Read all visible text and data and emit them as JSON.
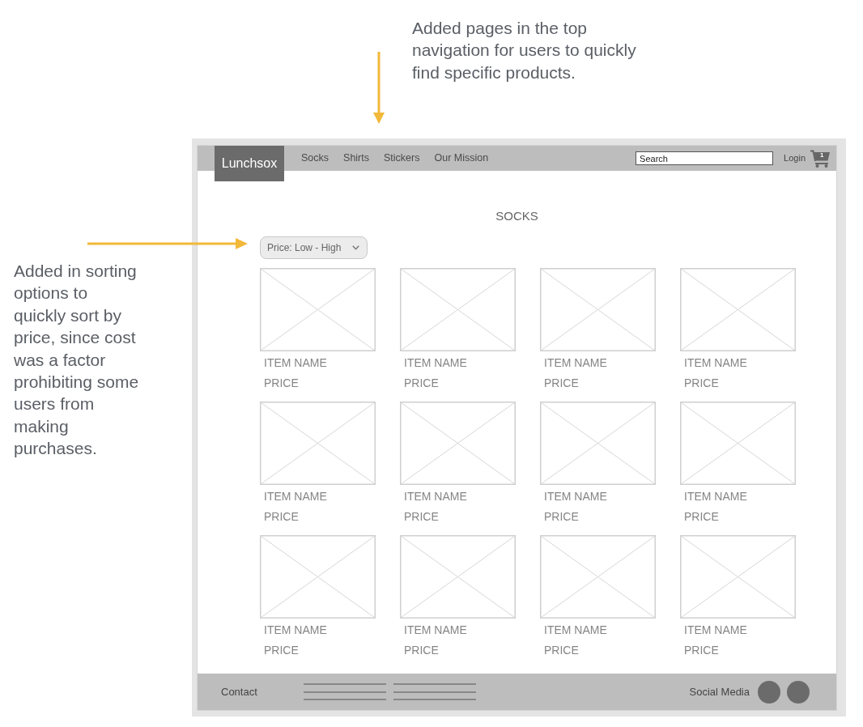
{
  "notes": {
    "top": "Added pages in the top navigation for users to quickly find specific products.",
    "left": "Added in sorting options to quickly sort by price, since cost was a factor prohibiting some users from making purchases."
  },
  "navbar": {
    "logo": "Lunchsox",
    "links": [
      {
        "label": "Socks"
      },
      {
        "label": "Shirts"
      },
      {
        "label": "Stickers"
      },
      {
        "label": "Our Mission"
      }
    ],
    "search": {
      "placeholder": "Search"
    },
    "login": "Login",
    "cart": {
      "count": "1"
    }
  },
  "page": {
    "title": "SOCKS",
    "sort": {
      "value": "Price: Low - High"
    }
  },
  "products": [
    {
      "name": "ITEM NAME",
      "price": "PRICE"
    },
    {
      "name": "ITEM NAME",
      "price": "PRICE"
    },
    {
      "name": "ITEM NAME",
      "price": "PRICE"
    },
    {
      "name": "ITEM NAME",
      "price": "PRICE"
    },
    {
      "name": "ITEM NAME",
      "price": "PRICE"
    },
    {
      "name": "ITEM NAME",
      "price": "PRICE"
    },
    {
      "name": "ITEM NAME",
      "price": "PRICE"
    },
    {
      "name": "ITEM NAME",
      "price": "PRICE"
    },
    {
      "name": "ITEM NAME",
      "price": "PRICE"
    },
    {
      "name": "ITEM NAME",
      "price": "PRICE"
    },
    {
      "name": "ITEM NAME",
      "price": "PRICE"
    },
    {
      "name": "ITEM NAME",
      "price": "PRICE"
    }
  ],
  "footer": {
    "contact": "Contact",
    "social": "Social Media"
  }
}
